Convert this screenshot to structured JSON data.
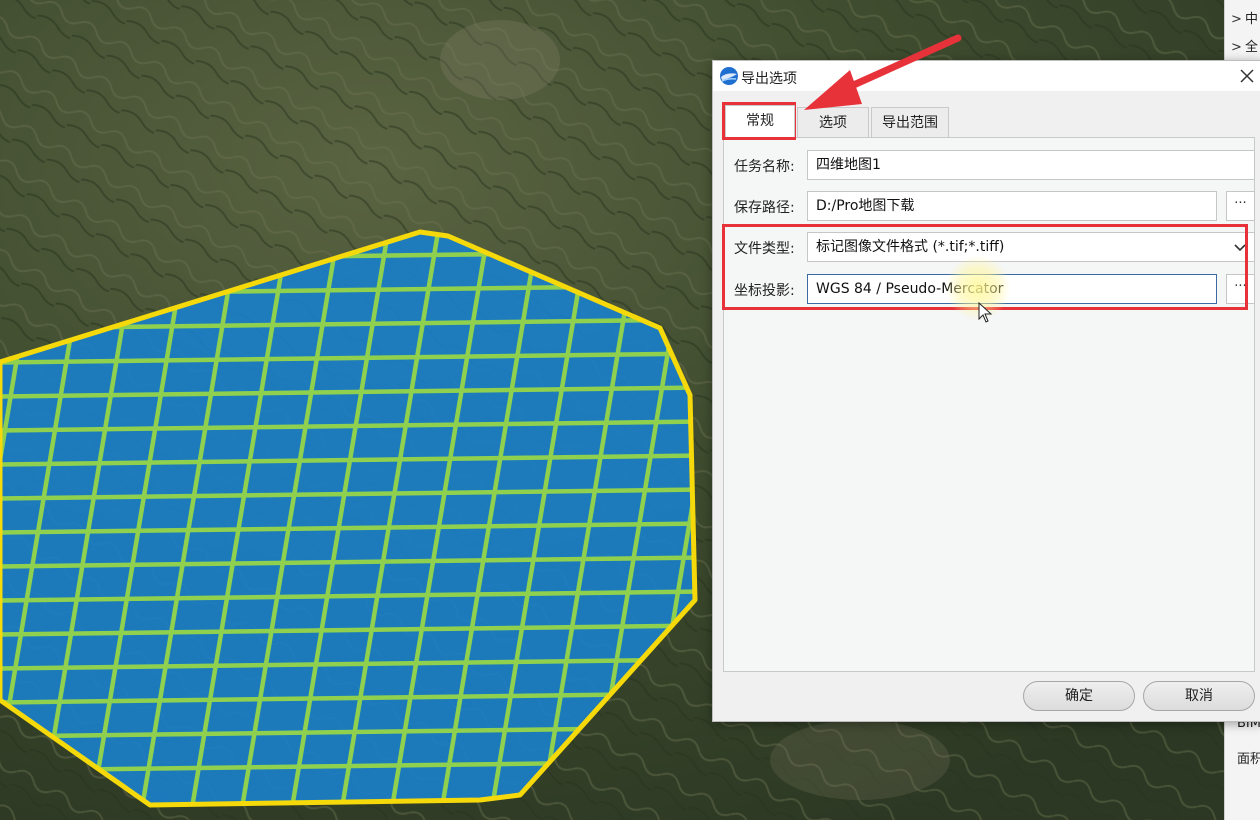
{
  "dialog": {
    "title": "导出选项",
    "tabs": [
      {
        "label": "常规",
        "active": true
      },
      {
        "label": "选项",
        "active": false
      },
      {
        "label": "导出范围",
        "active": false
      }
    ],
    "fields": {
      "task_name": {
        "label": "任务名称:",
        "value": "四维地图1"
      },
      "save_path": {
        "label": "保存路径:",
        "value": "D:/Pro地图下载",
        "browse_label": "···"
      },
      "file_type": {
        "label": "文件类型:",
        "value": "标记图像文件格式 (*.tif;*.tiff)"
      },
      "projection": {
        "label": "坐标投影:",
        "value": "WGS 84 / Pseudo-Mercator",
        "browse_label": "···"
      }
    },
    "buttons": {
      "ok": "确定",
      "cancel": "取消"
    }
  },
  "right_panel": {
    "items": [
      {
        "chevron": ">",
        "label": "中"
      },
      {
        "chevron": ">",
        "label": "全"
      }
    ],
    "fragments": [
      "BIM",
      "面积"
    ]
  },
  "colors": {
    "highlight_red": "#e8323a",
    "polygon_fill": "#1a7fc8",
    "polygon_border": "#f5d90a",
    "grid_lines": "#8fd14f"
  },
  "icons": {
    "app": "globe-icon",
    "close": "close-icon",
    "dropdown": "chevron-down-icon",
    "browse": "ellipsis-icon"
  }
}
